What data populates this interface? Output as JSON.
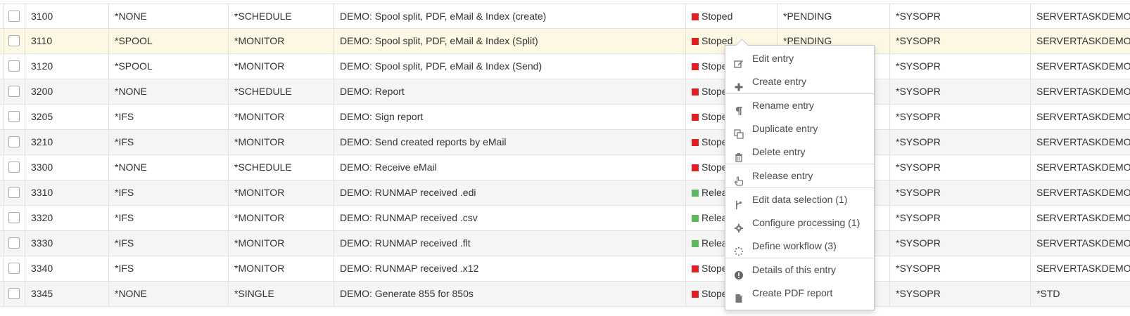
{
  "colors": {
    "status_stopped": "#e02020",
    "status_released": "#5cb85c",
    "row_highlight": "#fcf8e3",
    "row_alt": "#f5f5f5"
  },
  "rows": [
    {
      "id": "3100",
      "type": "*NONE",
      "mode": "*SCHEDULE",
      "description": "DEMO: Spool split, PDF, eMail & Index (create)",
      "status": "Stoped",
      "status_kind": "stopped",
      "pending": "*PENDING",
      "user": "*SYSOPR",
      "job": "SERVERTASKDEMO"
    },
    {
      "id": "3110",
      "type": "*SPOOL",
      "mode": "*MONITOR",
      "description": "DEMO: Spool split, PDF, eMail & Index (Split)",
      "status": "Stoped",
      "status_kind": "stopped",
      "pending": "*PENDING",
      "user": "*SYSOPR",
      "job": "SERVERTASKDEMO"
    },
    {
      "id": "3120",
      "type": "*SPOOL",
      "mode": "*MONITOR",
      "description": "DEMO: Spool split, PDF, eMail & Index (Send)",
      "status": "Stope",
      "status_kind": "stopped",
      "pending": "",
      "user": "*SYSOPR",
      "job": "SERVERTASKDEMO"
    },
    {
      "id": "3200",
      "type": "*NONE",
      "mode": "*SCHEDULE",
      "description": "DEMO: Report",
      "status": "Stope",
      "status_kind": "stopped",
      "pending": "",
      "user": "*SYSOPR",
      "job": "SERVERTASKDEMO"
    },
    {
      "id": "3205",
      "type": "*IFS",
      "mode": "*MONITOR",
      "description": "DEMO: Sign report",
      "status": "Stope",
      "status_kind": "stopped",
      "pending": "",
      "user": "*SYSOPR",
      "job": "SERVERTASKDEMO"
    },
    {
      "id": "3210",
      "type": "*IFS",
      "mode": "*MONITOR",
      "description": "DEMO: Send created reports by eMail",
      "status": "Stope",
      "status_kind": "stopped",
      "pending": "",
      "user": "*SYSOPR",
      "job": "SERVERTASKDEMO"
    },
    {
      "id": "3300",
      "type": "*NONE",
      "mode": "*SCHEDULE",
      "description": "DEMO: Receive eMail",
      "status": "Stope",
      "status_kind": "stopped",
      "pending": "",
      "user": "*SYSOPR",
      "job": "SERVERTASKDEMO"
    },
    {
      "id": "3310",
      "type": "*IFS",
      "mode": "*MONITOR",
      "description": "DEMO: RUNMAP received .edi",
      "status": "Relea",
      "status_kind": "released",
      "pending": "",
      "user": "*SYSOPR",
      "job": "SERVERTASKDEMO"
    },
    {
      "id": "3320",
      "type": "*IFS",
      "mode": "*MONITOR",
      "description": "DEMO: RUNMAP received .csv",
      "status": "Relea",
      "status_kind": "released",
      "pending": "",
      "user": "*SYSOPR",
      "job": "SERVERTASKDEMO"
    },
    {
      "id": "3330",
      "type": "*IFS",
      "mode": "*MONITOR",
      "description": "DEMO: RUNMAP received .flt",
      "status": "Relea",
      "status_kind": "released",
      "pending": "",
      "user": "*SYSOPR",
      "job": "SERVERTASKDEMO"
    },
    {
      "id": "3340",
      "type": "*IFS",
      "mode": "*MONITOR",
      "description": "DEMO: RUNMAP received .x12",
      "status": "Stope",
      "status_kind": "stopped",
      "pending": "",
      "user": "*SYSOPR",
      "job": "SERVERTASKDEMO"
    },
    {
      "id": "3345",
      "type": "*NONE",
      "mode": "*SINGLE",
      "description": "DEMO: Generate 855 for 850s",
      "status": "Stope",
      "status_kind": "stopped",
      "pending": "",
      "user": "*SYSOPR",
      "job": "*STD"
    }
  ],
  "highlighted_row": 1,
  "context_menu": {
    "groups": [
      [
        {
          "label": "Edit entry",
          "icon": "edit-icon"
        },
        {
          "label": "Create entry",
          "icon": "plus-icon"
        }
      ],
      [
        {
          "label": "Rename entry",
          "icon": "pilcrow-icon"
        },
        {
          "label": "Duplicate entry",
          "icon": "copy-icon"
        },
        {
          "label": "Delete entry",
          "icon": "trash-icon"
        }
      ],
      [
        {
          "label": "Release entry",
          "icon": "hand-pointer-icon"
        }
      ],
      [
        {
          "label": "Edit data selection (1)",
          "icon": "branch-icon"
        },
        {
          "label": "Configure processing (1)",
          "icon": "gear-icon"
        },
        {
          "label": "Define workflow (3)",
          "icon": "spinner-icon"
        }
      ],
      [
        {
          "label": "Details of this entry",
          "icon": "info-circle-icon"
        },
        {
          "label": "Create PDF report",
          "icon": "file-icon"
        }
      ]
    ]
  }
}
